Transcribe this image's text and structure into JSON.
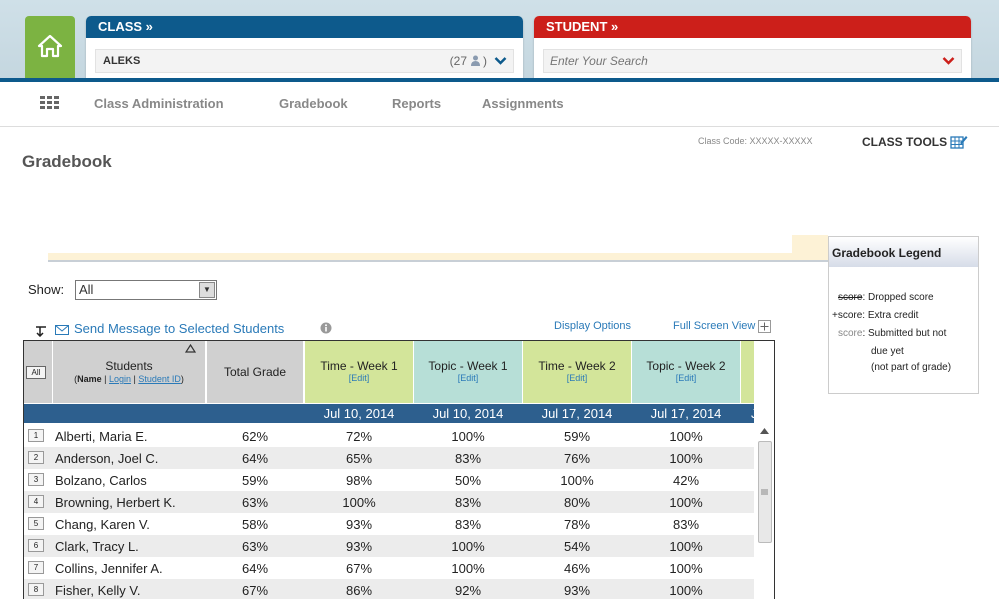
{
  "header": {
    "class_label": "CLASS »",
    "class_name": "ALEKS",
    "class_count": "(27",
    "class_count_close": ")",
    "student_label": "STUDENT »",
    "student_placeholder": "Enter Your Search"
  },
  "nav": [
    "Class Administration",
    "Gradebook",
    "Reports",
    "Assignments"
  ],
  "class_code": "Class Code: XXXXX-XXXXX",
  "class_tools": "CLASS TOOLS",
  "page_title": "Gradebook",
  "legend": {
    "title": "Gradebook Legend",
    "dropped_score": "score",
    "dropped_label": ": Dropped score",
    "extra_score": "+score",
    "extra_label": ": Extra credit",
    "submitted_score": "score",
    "submitted_label": ": Submitted but not",
    "submitted_label2": "due yet",
    "submitted_label3": "(not part of grade)"
  },
  "show": {
    "label": "Show:",
    "value": "All"
  },
  "send_message": "Send Message to Selected Students",
  "display_options": "Display Options",
  "full_screen": "Full Screen View",
  "table": {
    "all_button": "All",
    "students_header": "Students",
    "sort_name": "Name",
    "sort_login": "Login",
    "sort_id": "Student ID",
    "total_header": "Total Grade",
    "edit_label": "[Edit]",
    "columns": [
      {
        "title": "Time - Week 1",
        "date": "Jul 10, 2014",
        "color": "#d3e59a"
      },
      {
        "title": "Topic - Week 1",
        "date": "Jul 10, 2014",
        "color": "#b7dfd7"
      },
      {
        "title": "Time - Week 2",
        "date": "Jul 17, 2014",
        "color": "#d3e59a"
      },
      {
        "title": "Topic - Week 2",
        "date": "Jul 17, 2014",
        "color": "#b7dfd7"
      }
    ],
    "next_column_date_partial": "J",
    "rows": [
      {
        "n": "1",
        "name": "Alberti, Maria E.",
        "total": "62%",
        "s": [
          "72%",
          "100%",
          "59%",
          "100%"
        ]
      },
      {
        "n": "2",
        "name": "Anderson, Joel C.",
        "total": "64%",
        "s": [
          "65%",
          "83%",
          "76%",
          "100%"
        ]
      },
      {
        "n": "3",
        "name": "Bolzano, Carlos",
        "total": "59%",
        "s": [
          "98%",
          "50%",
          "100%",
          "42%"
        ]
      },
      {
        "n": "4",
        "name": "Browning, Herbert K.",
        "total": "63%",
        "s": [
          "100%",
          "83%",
          "80%",
          "100%"
        ]
      },
      {
        "n": "5",
        "name": "Chang, Karen V.",
        "total": "58%",
        "s": [
          "93%",
          "83%",
          "78%",
          "83%"
        ]
      },
      {
        "n": "6",
        "name": "Clark, Tracy L.",
        "total": "63%",
        "s": [
          "93%",
          "100%",
          "54%",
          "100%"
        ]
      },
      {
        "n": "7",
        "name": "Collins, Jennifer A.",
        "total": "64%",
        "s": [
          "67%",
          "100%",
          "46%",
          "100%"
        ]
      },
      {
        "n": "8",
        "name": "Fisher, Kelly V.",
        "total": "67%",
        "s": [
          "86%",
          "92%",
          "93%",
          "100%"
        ]
      }
    ]
  }
}
